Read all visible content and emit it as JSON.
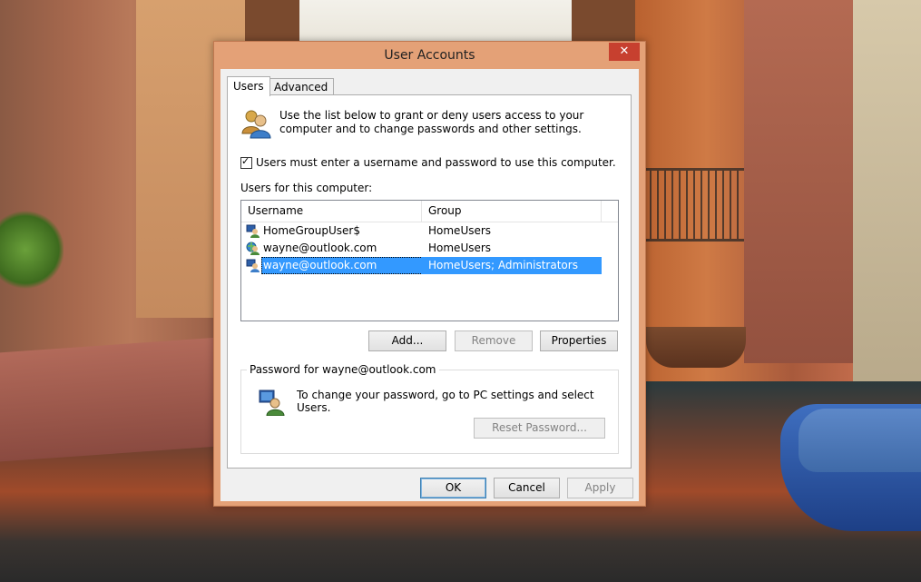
{
  "window": {
    "title": "User Accounts",
    "close_glyph": "✕"
  },
  "tabs": [
    {
      "label": "Users",
      "active": true
    },
    {
      "label": "Advanced",
      "active": false
    }
  ],
  "users_tab": {
    "intro_text": "Use the list below to grant or deny users access to your computer and to change passwords and other settings.",
    "require_login_checkbox": {
      "label": "Users must enter a username and password to use this computer.",
      "checked": true
    },
    "list_label": "Users for this computer:",
    "columns": [
      "Username",
      "Group"
    ],
    "rows": [
      {
        "username": "HomeGroupUser$",
        "group": "HomeUsers",
        "icon": "local-user-icon",
        "selected": false
      },
      {
        "username": "wayne@outlook.com",
        "group": "HomeUsers",
        "icon": "microsoft-account-icon",
        "selected": false
      },
      {
        "username": "wayne@outlook.com",
        "group": "HomeUsers; Administrators",
        "icon": "admin-user-icon",
        "selected": true
      }
    ],
    "buttons": {
      "add": "Add...",
      "remove": "Remove",
      "properties": "Properties"
    },
    "password_group": {
      "title": "Password for wayne@outlook.com",
      "text": "To change your password, go to PC settings and select Users.",
      "reset_button": "Reset Password..."
    }
  },
  "footer": {
    "ok": "OK",
    "cancel": "Cancel",
    "apply": "Apply"
  },
  "colors": {
    "window_frame": "#e4a177",
    "close_button": "#c7402f",
    "selection": "#3399ff"
  }
}
